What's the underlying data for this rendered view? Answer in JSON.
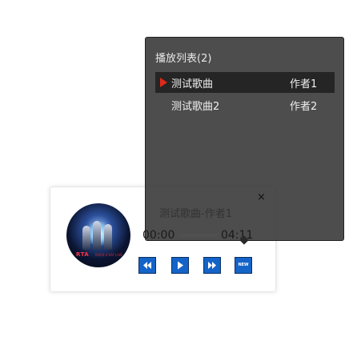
{
  "playlist": {
    "title": "播放列表(2)",
    "tracks": [
      {
        "name": "测试歌曲",
        "artist": "作者1",
        "active": true
      },
      {
        "name": "测试歌曲2",
        "artist": "作者2",
        "active": false
      }
    ]
  },
  "player": {
    "song_title": "测试歌曲-作者1",
    "current_time": "00:00",
    "duration": "04:11",
    "progress": 0,
    "close_label": "×",
    "new_label": "NEW",
    "cover_logo": "RTA",
    "cover_sub": "ROCK 4 SAY LIVE"
  },
  "colors": {
    "button_blue": "#1464c8",
    "active_marker": "#e0291a",
    "panel_bg": "#303030"
  },
  "icons": {
    "prev": "rewind-icon",
    "play": "play-icon",
    "next": "fast-forward-icon",
    "marker": "play-marker-icon"
  }
}
